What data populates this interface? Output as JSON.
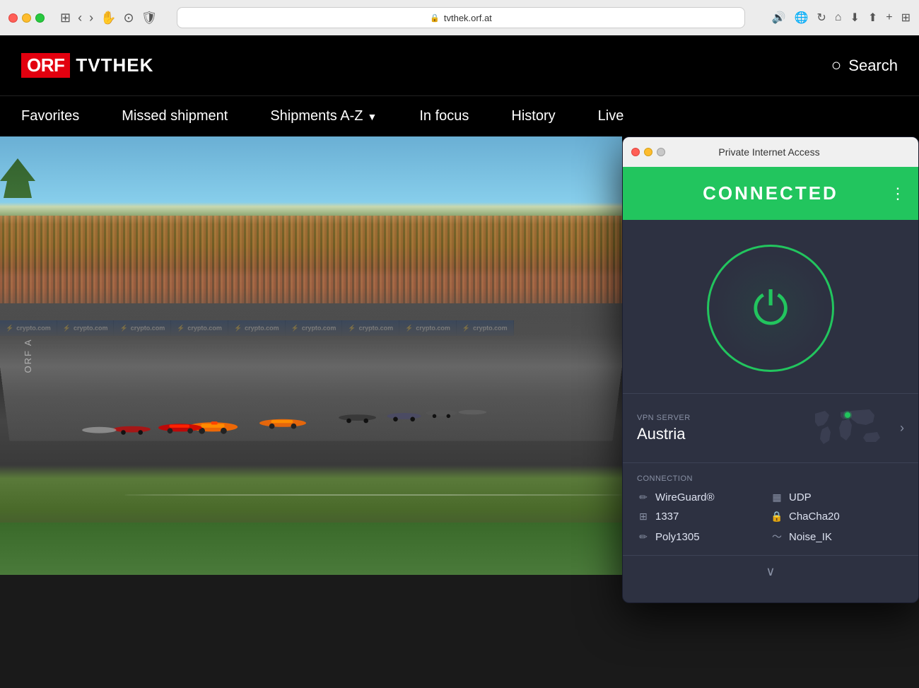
{
  "titlebar": {
    "url": "tvthek.orf.at",
    "lock_icon": "🔒"
  },
  "orf": {
    "logo_orf": "ORF",
    "logo_tvthek": "TVTHEK",
    "search_label": "Search",
    "nav_items": [
      {
        "id": "favorites",
        "label": "Favorites"
      },
      {
        "id": "missed-shipment",
        "label": "Missed shipment"
      },
      {
        "id": "shipments-az",
        "label": "Shipments A-Z",
        "has_dropdown": true
      },
      {
        "id": "in-focus",
        "label": "In focus"
      },
      {
        "id": "history",
        "label": "History"
      },
      {
        "id": "live",
        "label": "Live"
      }
    ],
    "orf_watermark": "ORF A",
    "banners": [
      "crypto.com",
      "crypto.com",
      "crypto.com",
      "crypto.com",
      "crypto.com",
      "crypto.com",
      "crypto.com",
      "crypto.com",
      "crypto.com"
    ]
  },
  "pia": {
    "title": "Private Internet Access",
    "connected_label": "CONNECTED",
    "menu_dots": "⋮",
    "vpn_server_label": "VPN SERVER",
    "vpn_server_value": "Austria",
    "connection_label": "CONNECTION",
    "connection_items": [
      {
        "id": "protocol",
        "icon": "✏️",
        "label": "WireGuard®"
      },
      {
        "id": "transport",
        "icon": "📋",
        "label": "UDP"
      },
      {
        "id": "port",
        "icon": "🔲",
        "label": "1337"
      },
      {
        "id": "cipher",
        "icon": "🔒",
        "label": "ChaCha20"
      },
      {
        "id": "handshake",
        "icon": "✏️",
        "label": "Poly1305"
      },
      {
        "id": "noise",
        "icon": "💨",
        "label": "Noise_IK"
      }
    ],
    "scroll_down_icon": "∨"
  }
}
